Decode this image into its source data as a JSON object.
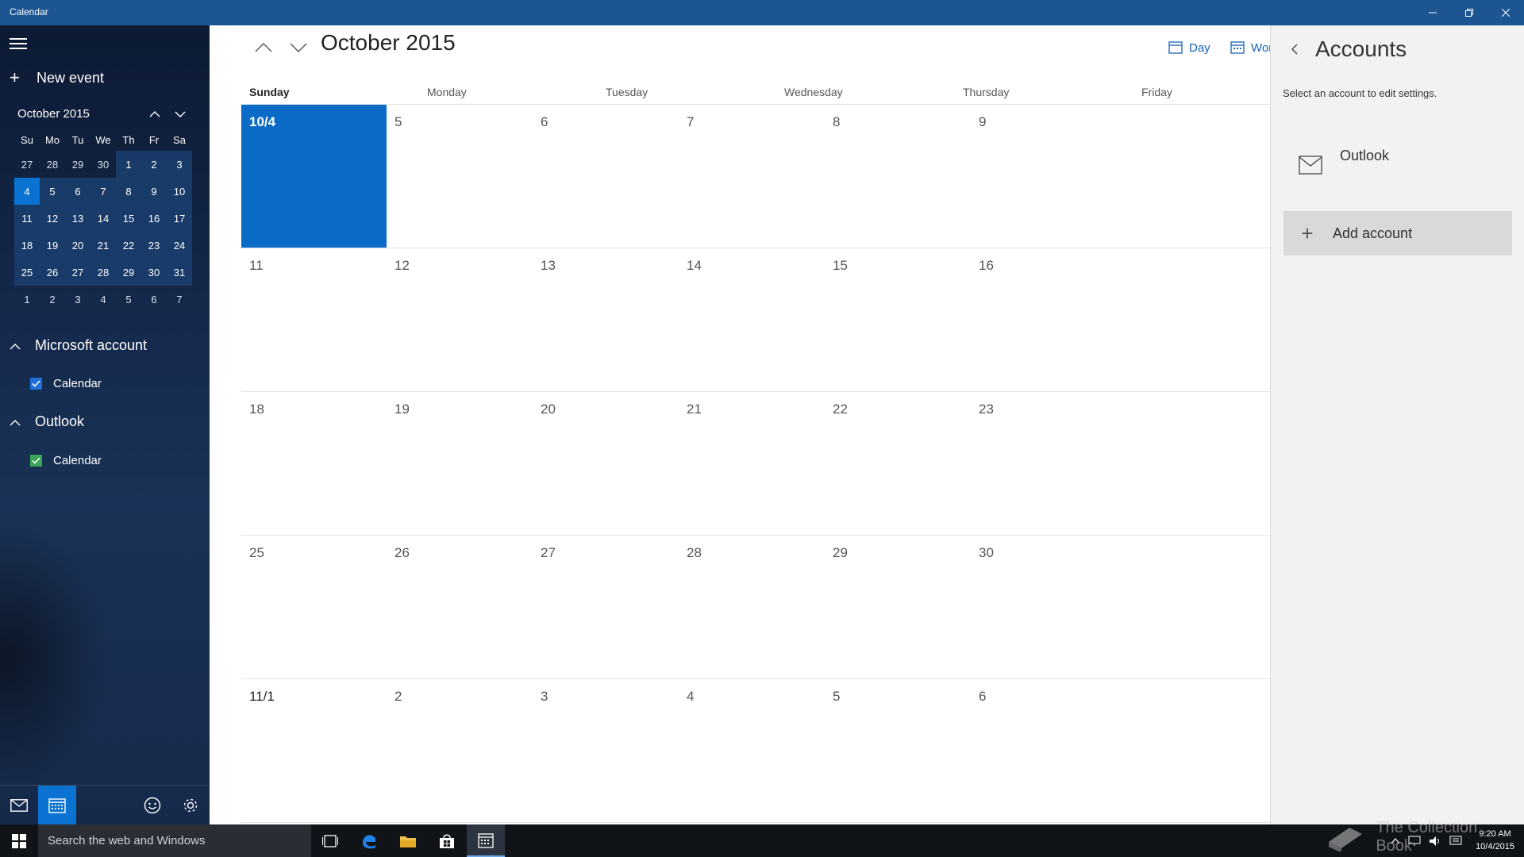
{
  "window": {
    "title": "Calendar"
  },
  "sidebar": {
    "new_event": "New event",
    "mini_calendar": {
      "month_label": "October 2015",
      "day_headers": [
        "Su",
        "Mo",
        "Tu",
        "We",
        "Th",
        "Fr",
        "Sa"
      ],
      "weeks": [
        [
          "27",
          "28",
          "29",
          "30",
          "1",
          "2",
          "3"
        ],
        [
          "4",
          "5",
          "6",
          "7",
          "8",
          "9",
          "10"
        ],
        [
          "11",
          "12",
          "13",
          "14",
          "15",
          "16",
          "17"
        ],
        [
          "18",
          "19",
          "20",
          "21",
          "22",
          "23",
          "24"
        ],
        [
          "25",
          "26",
          "27",
          "28",
          "29",
          "30",
          "31"
        ],
        [
          "1",
          "2",
          "3",
          "4",
          "5",
          "6",
          "7"
        ]
      ],
      "selected": "4"
    },
    "groups": [
      {
        "name": "Microsoft account",
        "calendars": [
          {
            "label": "Calendar",
            "checked": true,
            "color": "#1e6fd9"
          }
        ]
      },
      {
        "name": "Outlook",
        "calendars": [
          {
            "label": "Calendar",
            "checked": true,
            "color": "#3aa657"
          }
        ]
      }
    ],
    "bottom_icons": [
      "mail-icon",
      "calendar-icon",
      "feedback-smiley-icon",
      "settings-gear-icon"
    ]
  },
  "main": {
    "month_title": "October 2015",
    "views": [
      {
        "label": "Day",
        "icon": "day-view-icon"
      },
      {
        "label": "Wor",
        "icon": "work-week-view-icon"
      }
    ],
    "day_headers": [
      "Sunday",
      "Monday",
      "Tuesday",
      "Wednesday",
      "Thursday",
      "Friday"
    ],
    "weeks": [
      [
        "10/4",
        "5",
        "6",
        "7",
        "8",
        "9"
      ],
      [
        "11",
        "12",
        "13",
        "14",
        "15",
        "16"
      ],
      [
        "18",
        "19",
        "20",
        "21",
        "22",
        "23"
      ],
      [
        "25",
        "26",
        "27",
        "28",
        "29",
        "30"
      ],
      [
        "11/1",
        "2",
        "3",
        "4",
        "5",
        "6"
      ]
    ],
    "today_label": "10/4"
  },
  "accounts_panel": {
    "title": "Accounts",
    "subtitle": "Select an account to edit settings.",
    "accounts": [
      {
        "name": "Outlook",
        "icon": "mail-icon"
      }
    ],
    "add_account": "Add account"
  },
  "taskbar": {
    "search_placeholder": "Search the web and Windows",
    "time": "9:20 AM",
    "date": "10/4/2015",
    "watermark": "The Collection Book"
  },
  "colors": {
    "titlebar": "#1d5592",
    "accent": "#0a6cc6",
    "sidebar_bg": "#14284a",
    "flyout_bg": "#f2f2f2"
  }
}
